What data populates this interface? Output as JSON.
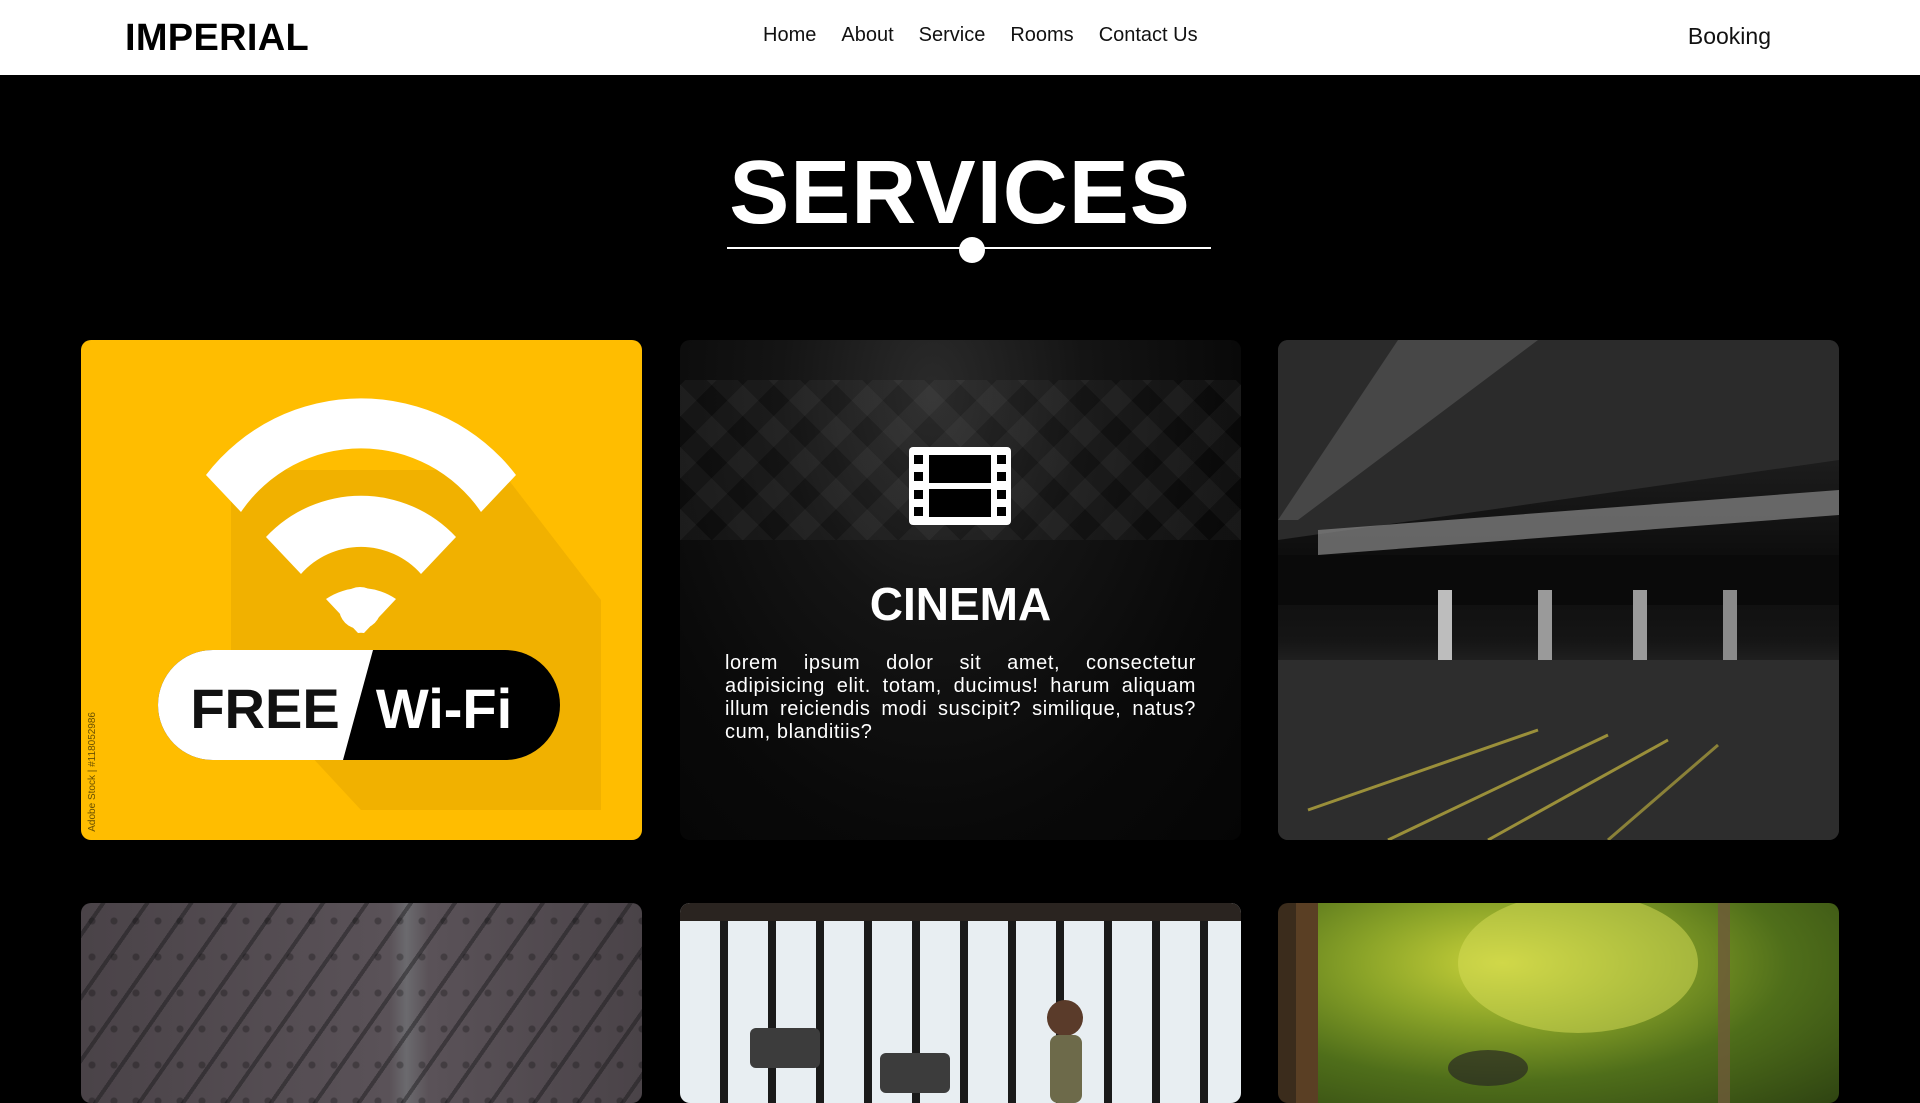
{
  "header": {
    "logo": "IMPERIAL",
    "nav": [
      "Home",
      "About",
      "Service",
      "Rooms",
      "Contact Us"
    ],
    "booking": "Booking"
  },
  "section": {
    "title": "SERVICES"
  },
  "cards": {
    "wifi": {
      "free_text": "FREE",
      "wifi_text": "Wi-Fi",
      "stock_caption": "Adobe Stock | #118052986",
      "accent": "#ffbd00"
    },
    "cinema": {
      "icon": "film-icon",
      "title": "CINEMA",
      "text": "lorem ipsum dolor sit amet, consectetur adipisicing elit. totam, ducimus! harum aliquam illum reiciendis modi suscipit? similique, natus? cum, blanditiis?"
    },
    "parking": {
      "image": "parking-garage-image"
    },
    "cctv": {
      "image": "cctv-cameras-image"
    },
    "gym": {
      "image": "gym-treadmill-image"
    },
    "garden": {
      "image": "garden-path-image"
    }
  }
}
